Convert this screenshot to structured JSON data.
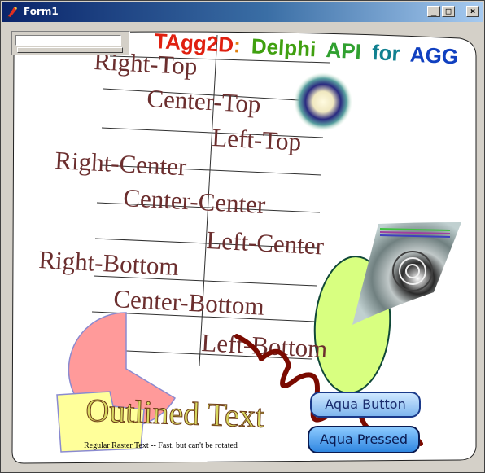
{
  "window": {
    "title": "Form1",
    "min_glyph": "_",
    "max_glyph": "□",
    "close_glyph": "×"
  },
  "canvas": {
    "heading": {
      "text_1": "TAgg2D",
      "text_2": ":",
      "text_3": "Delphi",
      "text_4": "API",
      "text_5": "for",
      "text_6": "AGG"
    },
    "labels": {
      "right_top": "Right-Top",
      "center_top": "Center-Top",
      "left_top": "Left-Top",
      "right_center": "Right-Center",
      "center_center": "Center-Center",
      "left_center": "Left-Center",
      "right_bottom": "Right-Bottom",
      "center_bottom": "Center-Bottom",
      "left_bottom": "Left-Bottom"
    },
    "outlined_text": "Outlined Text",
    "raster_text": "Regular Raster Text -- Fast, but can't be rotated"
  },
  "buttons": {
    "aqua_button": "Aqua Button",
    "aqua_pressed": "Aqua Pressed"
  },
  "colors": {
    "title_gradient_start": "#0a246a",
    "label_text": "#6b2e2e",
    "heading_red": "#e02010",
    "heading_green": "#40a010",
    "heading_teal": "#108090",
    "heading_blue": "#1040c0"
  }
}
